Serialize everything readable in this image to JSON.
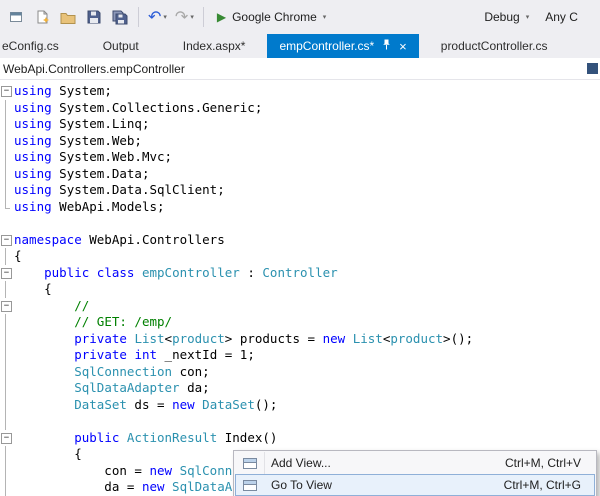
{
  "toolbar": {
    "run_label": "Google Chrome",
    "config_label": "Debug",
    "platform_label": "Any C"
  },
  "icons": {
    "undo": "↶",
    "redo": "↷",
    "dropdown": "▾",
    "play": "▶",
    "close": "×"
  },
  "tabs": [
    {
      "label": "eConfig.cs",
      "active": false
    },
    {
      "label": "Output",
      "active": false
    },
    {
      "label": "Index.aspx*",
      "active": false
    },
    {
      "label": "empController.cs*",
      "active": true
    },
    {
      "label": "productController.cs",
      "active": false
    }
  ],
  "breadcrumb": "WebApi.Controllers.empController",
  "editor": {
    "lines": [
      {
        "fold": "box",
        "tokens": [
          [
            "k",
            "using"
          ],
          [
            "p",
            " System;"
          ]
        ]
      },
      {
        "fold": "line",
        "tokens": [
          [
            "k",
            "using"
          ],
          [
            "p",
            " System.Collections.Generic;"
          ]
        ]
      },
      {
        "fold": "line",
        "tokens": [
          [
            "k",
            "using"
          ],
          [
            "p",
            " System.Linq;"
          ]
        ]
      },
      {
        "fold": "line",
        "tokens": [
          [
            "k",
            "using"
          ],
          [
            "p",
            " System.Web;"
          ]
        ]
      },
      {
        "fold": "line",
        "tokens": [
          [
            "k",
            "using"
          ],
          [
            "p",
            " System.Web.Mvc;"
          ]
        ]
      },
      {
        "fold": "line",
        "tokens": [
          [
            "k",
            "using"
          ],
          [
            "p",
            " System.Data;"
          ]
        ]
      },
      {
        "fold": "line",
        "tokens": [
          [
            "k",
            "using"
          ],
          [
            "p",
            " System.Data.SqlClient;"
          ]
        ]
      },
      {
        "fold": "end",
        "tokens": [
          [
            "k",
            "using"
          ],
          [
            "p",
            " WebApi.Models;"
          ]
        ]
      },
      {
        "fold": "none",
        "tokens": []
      },
      {
        "fold": "box",
        "tokens": [
          [
            "k",
            "namespace"
          ],
          [
            "p",
            " WebApi.Controllers"
          ]
        ]
      },
      {
        "fold": "line",
        "tokens": [
          [
            "p",
            "{"
          ]
        ]
      },
      {
        "fold": "box",
        "tokens": [
          [
            "p",
            "    "
          ],
          [
            "k",
            "public"
          ],
          [
            "p",
            " "
          ],
          [
            "k",
            "class"
          ],
          [
            "p",
            " "
          ],
          [
            "t",
            "empController"
          ],
          [
            "p",
            " : "
          ],
          [
            "t",
            "Controller"
          ]
        ]
      },
      {
        "fold": "line",
        "tokens": [
          [
            "p",
            "    {"
          ]
        ]
      },
      {
        "fold": "box",
        "tokens": [
          [
            "p",
            "        "
          ],
          [
            "c",
            "//"
          ]
        ]
      },
      {
        "fold": "line",
        "tokens": [
          [
            "p",
            "        "
          ],
          [
            "c",
            "// GET: /emp/"
          ]
        ]
      },
      {
        "fold": "line",
        "tokens": [
          [
            "p",
            "        "
          ],
          [
            "k",
            "private"
          ],
          [
            "p",
            " "
          ],
          [
            "t",
            "List"
          ],
          [
            "p",
            "<"
          ],
          [
            "t",
            "product"
          ],
          [
            "p",
            "> products = "
          ],
          [
            "k",
            "new"
          ],
          [
            "p",
            " "
          ],
          [
            "t",
            "List"
          ],
          [
            "p",
            "<"
          ],
          [
            "t",
            "product"
          ],
          [
            "p",
            ">();"
          ]
        ]
      },
      {
        "fold": "line",
        "tokens": [
          [
            "p",
            "        "
          ],
          [
            "k",
            "private"
          ],
          [
            "p",
            " "
          ],
          [
            "k",
            "int"
          ],
          [
            "p",
            " _nextId = 1;"
          ]
        ]
      },
      {
        "fold": "line",
        "tokens": [
          [
            "p",
            "        "
          ],
          [
            "t",
            "SqlConnection"
          ],
          [
            "p",
            " con;"
          ]
        ]
      },
      {
        "fold": "line",
        "tokens": [
          [
            "p",
            "        "
          ],
          [
            "t",
            "SqlDataAdapter"
          ],
          [
            "p",
            " da;"
          ]
        ]
      },
      {
        "fold": "line",
        "tokens": [
          [
            "p",
            "        "
          ],
          [
            "t",
            "DataSet"
          ],
          [
            "p",
            " ds = "
          ],
          [
            "k",
            "new"
          ],
          [
            "p",
            " "
          ],
          [
            "t",
            "DataSet"
          ],
          [
            "p",
            "();"
          ]
        ]
      },
      {
        "fold": "line",
        "tokens": []
      },
      {
        "fold": "box",
        "tokens": [
          [
            "p",
            "        "
          ],
          [
            "k",
            "public"
          ],
          [
            "p",
            " "
          ],
          [
            "t",
            "ActionResult"
          ],
          [
            "p",
            " Index()"
          ]
        ]
      },
      {
        "fold": "line",
        "tokens": [
          [
            "p",
            "        {"
          ]
        ]
      },
      {
        "fold": "line",
        "tokens": [
          [
            "p",
            "            con = "
          ],
          [
            "k",
            "new"
          ],
          [
            "p",
            " "
          ],
          [
            "t",
            "SqlConnec"
          ]
        ]
      },
      {
        "fold": "line",
        "tokens": [
          [
            "p",
            "            da = "
          ],
          [
            "k",
            "new"
          ],
          [
            "p",
            " "
          ],
          [
            "t",
            "SqlDataAda"
          ]
        ]
      }
    ]
  },
  "context_menu": {
    "items": [
      {
        "label": "Add View...",
        "shortcut": "Ctrl+M, Ctrl+V",
        "selected": false
      },
      {
        "label": "Go To View",
        "shortcut": "Ctrl+M, Ctrl+G",
        "selected": true
      }
    ]
  },
  "colors": {
    "accent": "#007acc",
    "keyword": "#0000ff",
    "type": "#2b91af",
    "comment": "#008000",
    "toolbar_bg": "#eeeef2"
  }
}
